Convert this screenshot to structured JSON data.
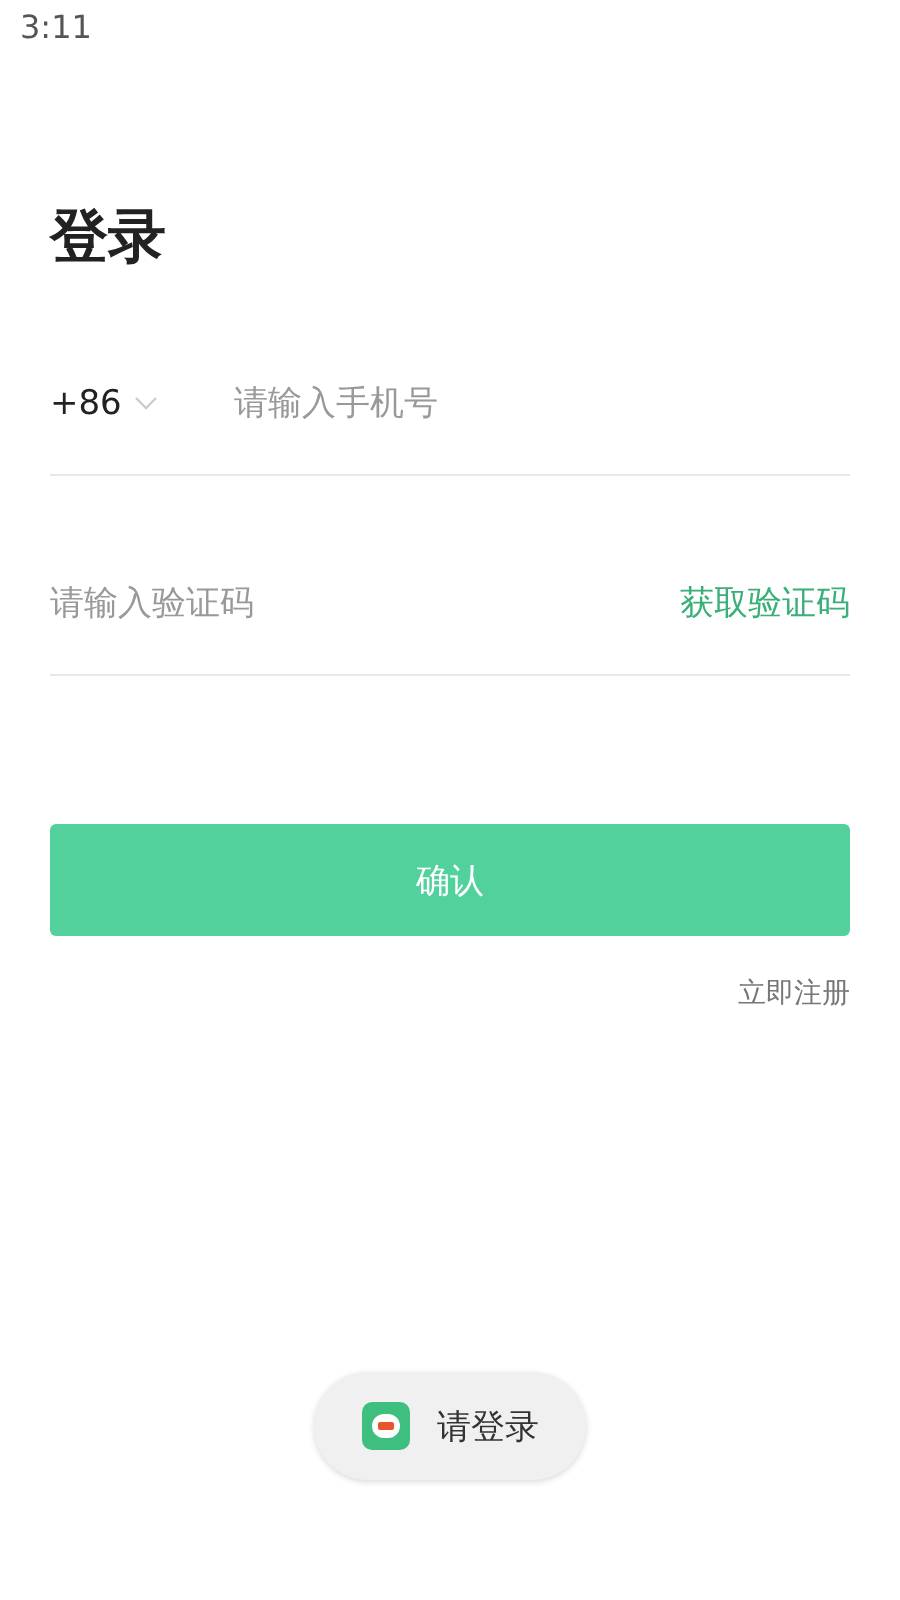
{
  "status_bar": {
    "time": "3:11"
  },
  "title": "登录",
  "phone": {
    "country_code": "+86",
    "placeholder": "请输入手机号"
  },
  "code": {
    "placeholder": "请输入验证码",
    "action": "获取验证码"
  },
  "confirm_button": "确认",
  "register_link": "立即注册",
  "toast": {
    "text": "请登录"
  }
}
